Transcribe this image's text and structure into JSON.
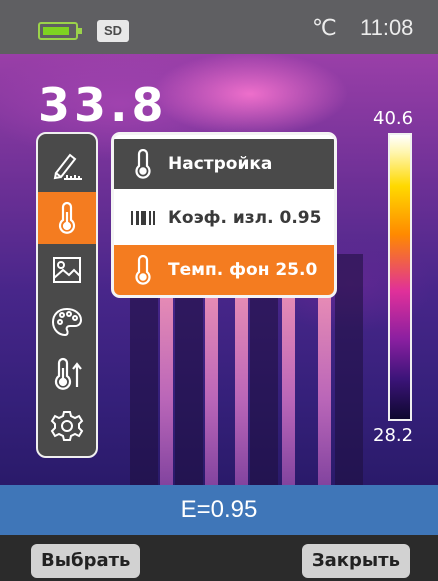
{
  "status_bar": {
    "battery_icon": "battery-icon",
    "storage_badge": "SD",
    "temperature_unit": "℃",
    "time": "11:08"
  },
  "reading": {
    "center_temperature": "33.8"
  },
  "color_scale": {
    "max_label": "40.6",
    "min_label": "28.2",
    "palette": "iron"
  },
  "side_menu": {
    "items": [
      {
        "icon": "measure-tool-icon",
        "active": false
      },
      {
        "icon": "thermometer-icon",
        "active": true
      },
      {
        "icon": "image-gallery-icon",
        "active": false
      },
      {
        "icon": "palette-icon",
        "active": false
      },
      {
        "icon": "temperature-alarm-icon",
        "active": false
      },
      {
        "icon": "gear-icon",
        "active": false
      }
    ]
  },
  "popup": {
    "header_label": "Настройка",
    "emissivity_label": "Коэф. изл. 0.95",
    "background_temp_label": "Темп. фон 25.0"
  },
  "emissivity_bar": {
    "text": "E=0.95"
  },
  "softkeys": {
    "left_label": "Выбрать",
    "right_label": "Закрыть"
  },
  "colors": {
    "accent": "#f47c20",
    "menu_bg": "#4a4a4a",
    "status_bg": "#5f5f62",
    "info_bar": "#3f76b8"
  }
}
